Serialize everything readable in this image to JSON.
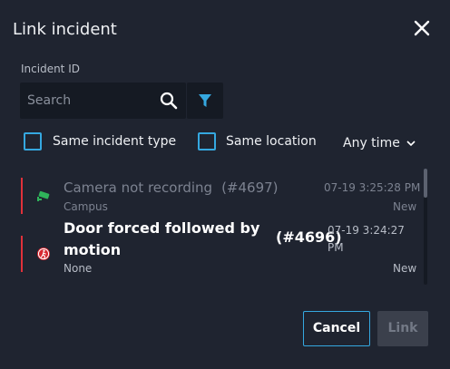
{
  "dialog": {
    "title": "Link incident",
    "close_icon": "close-icon"
  },
  "search": {
    "label": "Incident ID",
    "placeholder": "Search",
    "value": "",
    "search_icon": "search-icon",
    "filter_icon": "filter-icon"
  },
  "filters": {
    "same_incident_type": {
      "label": "Same incident type",
      "checked": false
    },
    "same_location": {
      "label": "Same location",
      "checked": false
    },
    "time_range": {
      "label": "Any time",
      "icon": "chevron-down-icon"
    }
  },
  "incidents": [
    {
      "name": "Camera not recording",
      "number": "(#4697)",
      "location": "Campus",
      "datetime": "07-19 3:25:28 PM",
      "status": "New",
      "icon": "camera-icon",
      "priority_color": "#e0313a"
    },
    {
      "name": "Door forced followed by motion",
      "number": "(#4696)",
      "location": "None",
      "datetime": "07-19 3:24:27 PM",
      "status": "New",
      "icon": "intrusion-icon",
      "priority_color": "#e0313a"
    }
  ],
  "actions": {
    "cancel_label": "Cancel",
    "link_label": "Link"
  },
  "colors": {
    "accent": "#35a8e0",
    "background": "#1f2430",
    "input_background": "#151a23",
    "priority": "#e0313a"
  }
}
